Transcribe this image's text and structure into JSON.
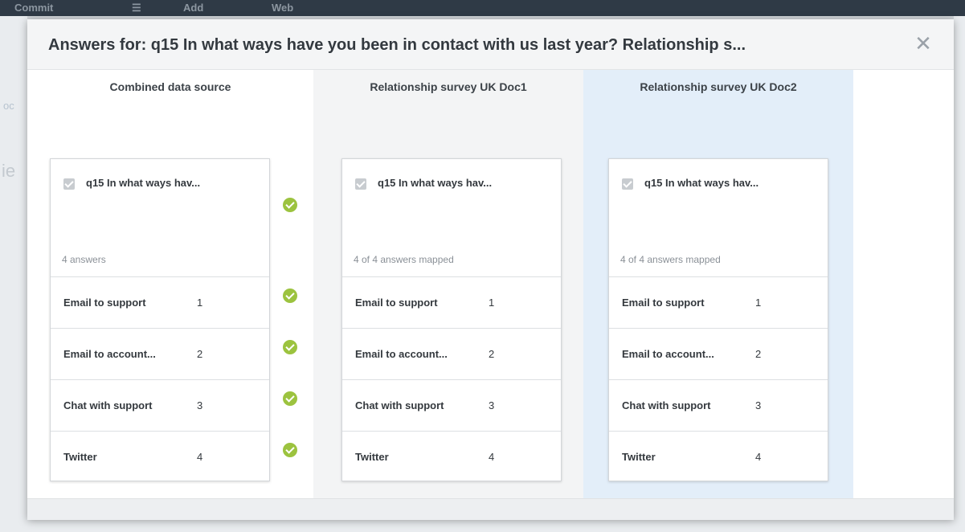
{
  "background": {
    "topbar_items": [
      "Commit",
      "☰",
      "Add",
      "Web"
    ]
  },
  "modal": {
    "title": "Answers for: q15 In what ways have you been in contact with us last year? Relationship s...",
    "close_icon": "close-icon"
  },
  "columns": [
    {
      "header": "Combined data source",
      "question": "q15 In what ways hav...",
      "summary": "4 answers",
      "rows": [
        {
          "label": "Email to support",
          "value": "1"
        },
        {
          "label": "Email to account...",
          "value": "2"
        },
        {
          "label": "Chat with support",
          "value": "3"
        },
        {
          "label": "Twitter",
          "value": "4"
        }
      ]
    },
    {
      "header": "Relationship survey UK Doc1",
      "question": "q15 In what ways hav...",
      "summary": "4 of 4 answers mapped",
      "rows": [
        {
          "label": "Email to support",
          "value": "1"
        },
        {
          "label": "Email to account...",
          "value": "2"
        },
        {
          "label": "Chat with support",
          "value": "3"
        },
        {
          "label": "Twitter",
          "value": "4"
        }
      ]
    },
    {
      "header": "Relationship survey UK Doc2",
      "question": "q15 In what ways hav...",
      "summary": "4 of 4 answers mapped",
      "rows": [
        {
          "label": "Email to support",
          "value": "1"
        },
        {
          "label": "Email to account...",
          "value": "2"
        },
        {
          "label": "Chat with support",
          "value": "3"
        },
        {
          "label": "Twitter",
          "value": "4"
        }
      ]
    }
  ],
  "colors": {
    "check_green": "#9cc33f",
    "doc2_highlight": "#e3eef9",
    "doc1_background": "#f3f4f5"
  }
}
